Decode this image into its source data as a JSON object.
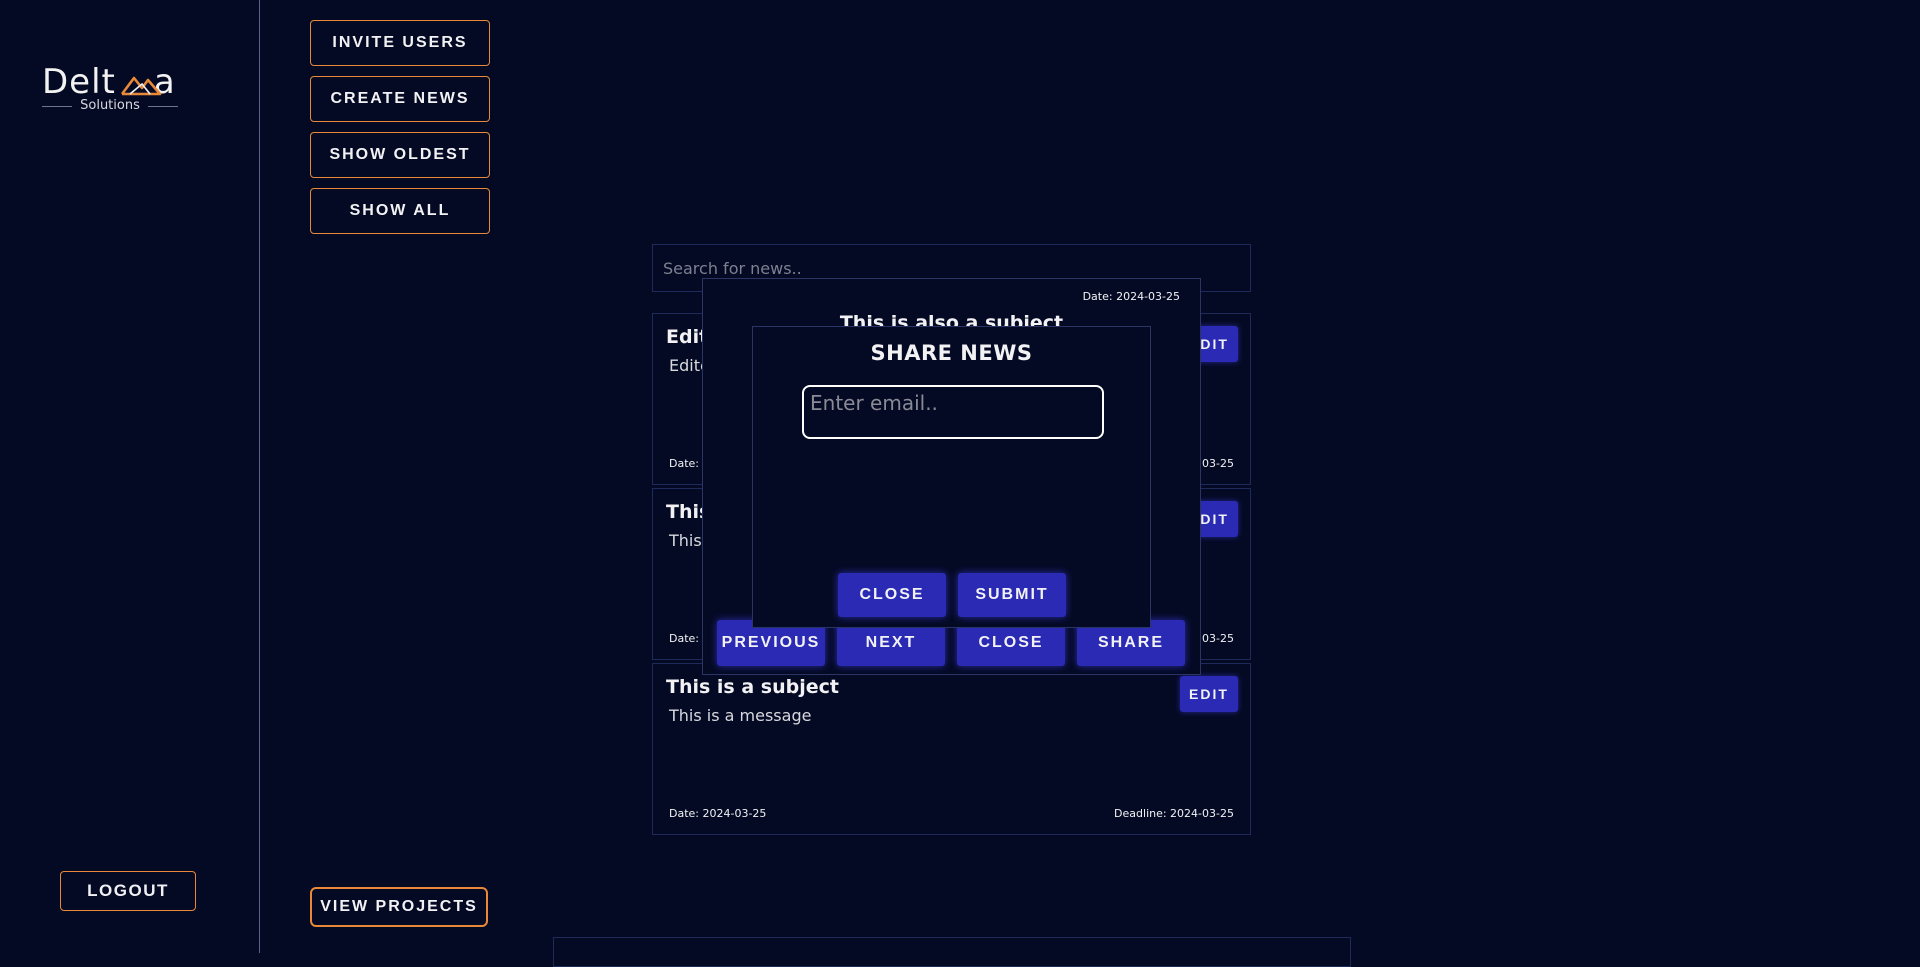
{
  "brand": {
    "name_left": "Delt",
    "name_right": "a",
    "subtitle": "Solutions",
    "accent_color": "#e8893a"
  },
  "sidebar": {
    "logout_label": "LOGOUT"
  },
  "actions": {
    "invite_users": "INVITE USERS",
    "create_news": "CREATE NEWS",
    "show_oldest": "SHOW OLDEST",
    "show_all": "SHOW ALL",
    "view_projects": "VIEW PROJECTS"
  },
  "search": {
    "placeholder": "Search for news.."
  },
  "news": [
    {
      "subject": "Edit",
      "message": "Edite",
      "date": "Date: 2",
      "deadline": "03-25",
      "edit_label": "EDIT"
    },
    {
      "subject": "This",
      "message": "This",
      "date": "Date: 2",
      "deadline": "03-25",
      "edit_label": "EDIT"
    },
    {
      "subject": "This is a subject",
      "message": "This is a message",
      "date": "Date: 2024-03-25",
      "deadline": "Deadline: 2024-03-25",
      "edit_label": "EDIT"
    }
  ],
  "view_modal": {
    "date": "Date: 2024-03-25",
    "subject": "This is also a subject",
    "previous_label": "PREVIOUS",
    "next_label": "NEXT",
    "close_label": "CLOSE",
    "share_label": "SHARE"
  },
  "share_modal": {
    "title": "SHARE NEWS",
    "email_placeholder": "Enter email..",
    "close_label": "CLOSE",
    "submit_label": "SUBMIT"
  },
  "colors": {
    "background": "#050a24",
    "button_primary": "#2a2ab4",
    "border": "#1f2a5a"
  }
}
